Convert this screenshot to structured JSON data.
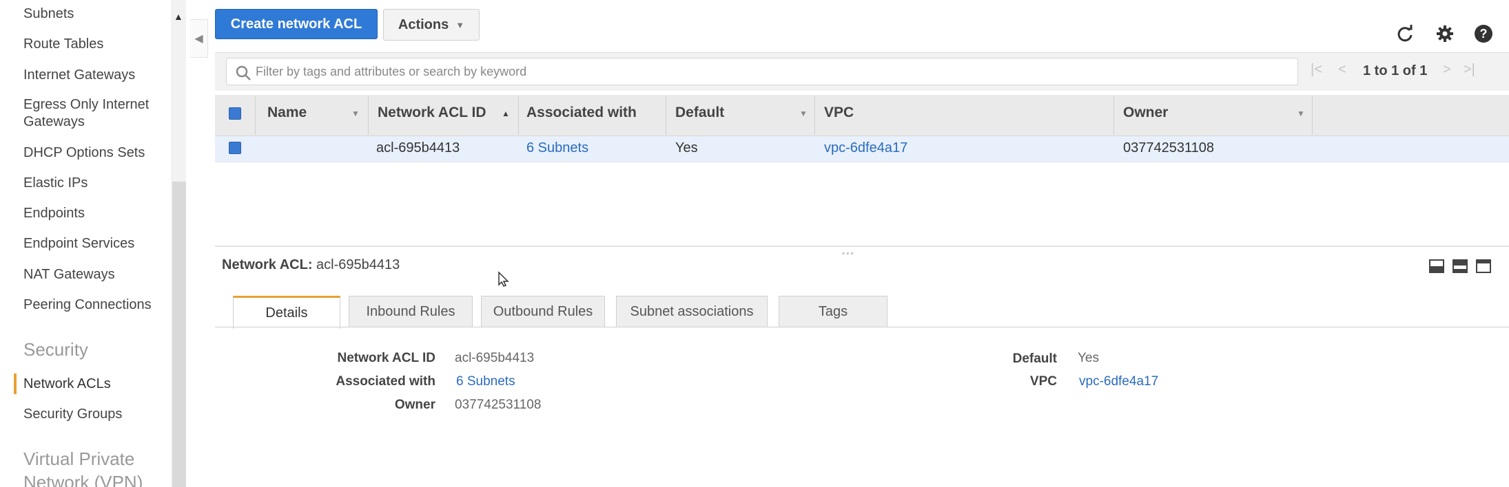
{
  "sidebar": {
    "items": [
      {
        "label": "Subnets"
      },
      {
        "label": "Route Tables"
      },
      {
        "label": "Internet Gateways"
      },
      {
        "label": "Egress Only Internet Gateways",
        "line1": "Egress Only Internet",
        "line2": "Gateways"
      },
      {
        "label": "DHCP Options Sets"
      },
      {
        "label": "Elastic IPs"
      },
      {
        "label": "Endpoints"
      },
      {
        "label": "Endpoint Services"
      },
      {
        "label": "NAT Gateways"
      },
      {
        "label": "Peering Connections"
      }
    ],
    "security_heading": "Security",
    "security_items": [
      {
        "label": "Network ACLs",
        "active": true
      },
      {
        "label": "Security Groups"
      }
    ],
    "vpn_heading_line1": "Virtual Private",
    "vpn_heading_line2": "Network (VPN)"
  },
  "toolbar": {
    "create_label": "Create network ACL",
    "actions_label": "Actions",
    "icons": [
      "refresh-icon",
      "gear-icon",
      "help-icon"
    ]
  },
  "filter": {
    "placeholder": "Filter by tags and attributes or search by keyword",
    "pagination": "1 to 1 of 1"
  },
  "table": {
    "columns": [
      "Name",
      "Network ACL ID",
      "Associated with",
      "Default",
      "VPC",
      "Owner"
    ],
    "rows": [
      {
        "name": "",
        "acl_id": "acl-695b4413",
        "associated": "6 Subnets",
        "default": "Yes",
        "vpc": "vpc-6dfe4a17",
        "owner": "037742531108"
      }
    ]
  },
  "details": {
    "title_label": "Network ACL:",
    "title_value": "acl-695b4413",
    "tabs": [
      "Details",
      "Inbound Rules",
      "Outbound Rules",
      "Subnet associations",
      "Tags"
    ],
    "active_tab": "Details",
    "fields": {
      "acl_id_label": "Network ACL ID",
      "acl_id_value": "acl-695b4413",
      "associated_label": "Associated with",
      "associated_value": "6 Subnets",
      "owner_label": "Owner",
      "owner_value": "037742531108",
      "default_label": "Default",
      "default_value": "Yes",
      "vpc_label": "VPC",
      "vpc_value": "vpc-6dfe4a17"
    }
  },
  "colors": {
    "primary_button": "#2f7ad6",
    "link": "#2a6bc0",
    "active_accent": "#e7a132",
    "selected_row": "#e8f0fb"
  }
}
